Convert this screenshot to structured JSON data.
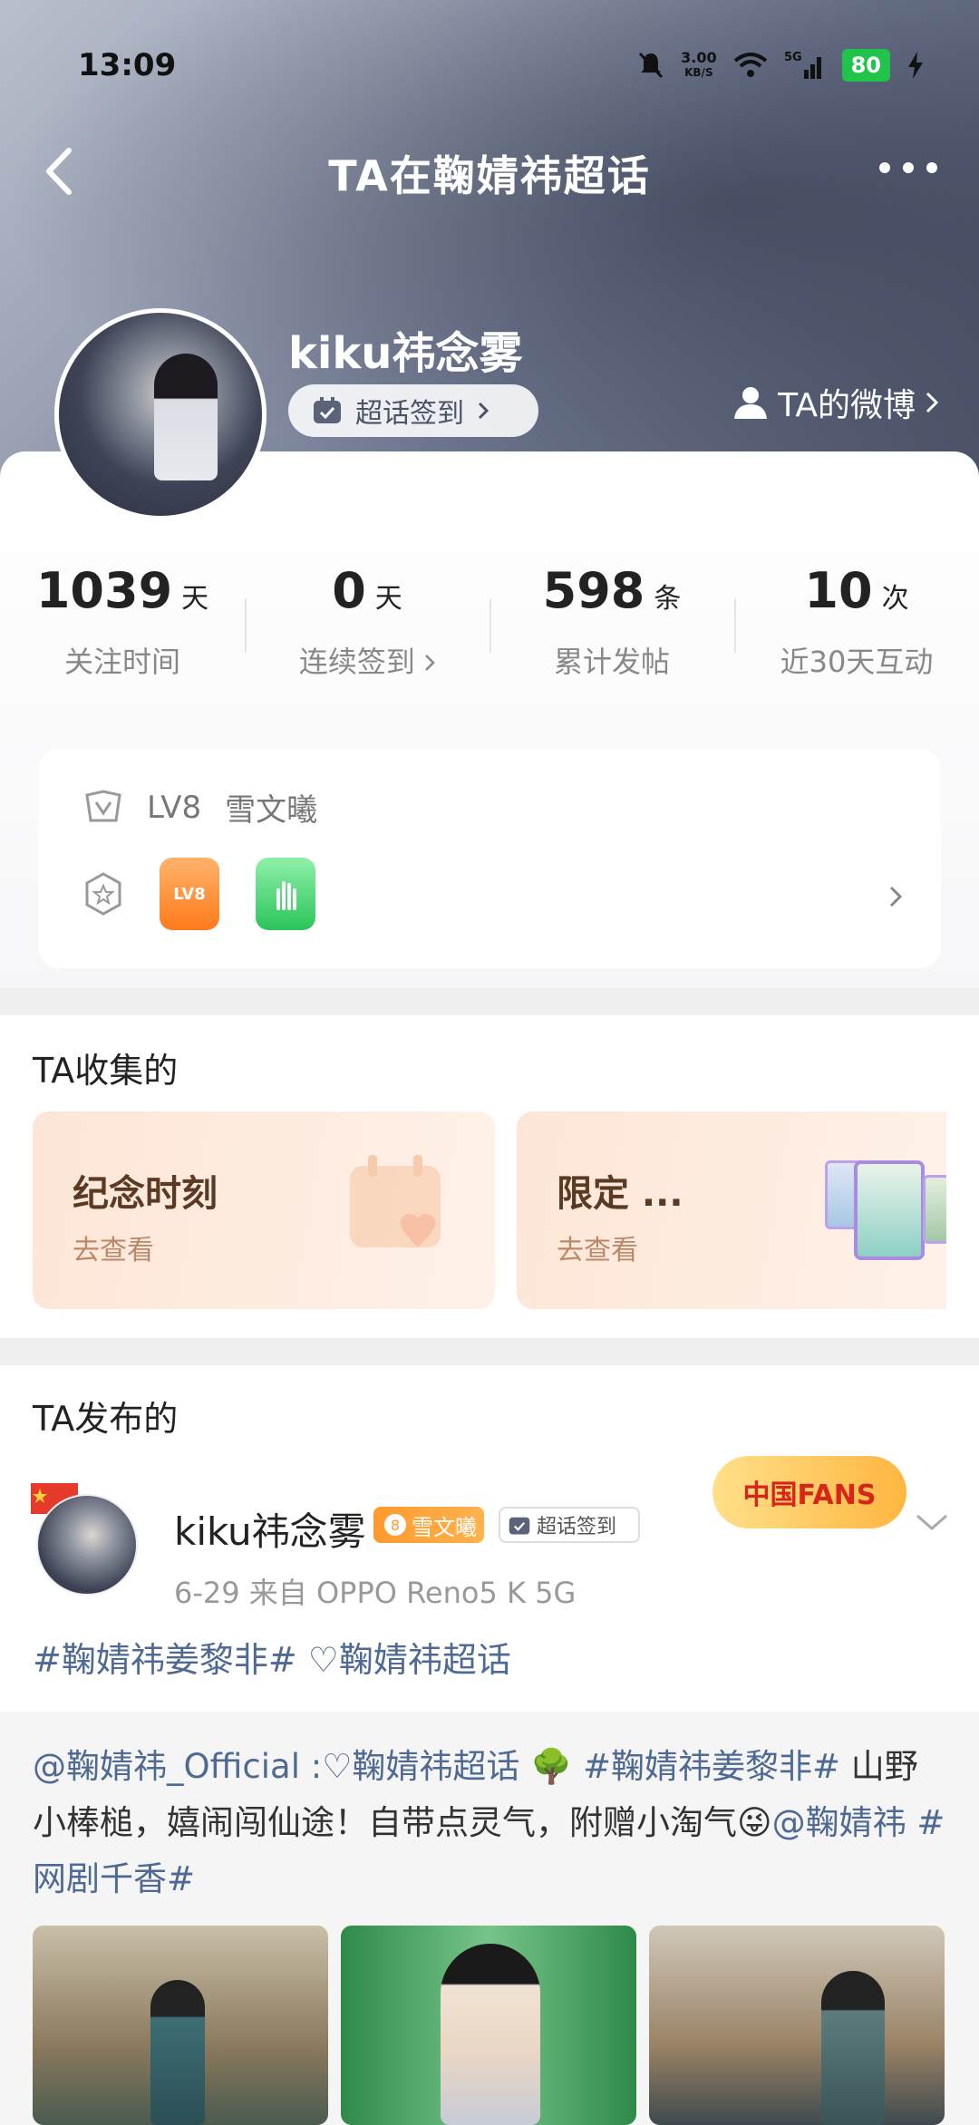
{
  "status_bar": {
    "time": "13:09",
    "speed_value": "3.00",
    "speed_unit": "KB/S",
    "network": "5G",
    "battery": "80"
  },
  "nav": {
    "title": "TA在鞠婧祎超话",
    "back_icon": "chevron-left-icon",
    "more_icon": "more-dots-icon"
  },
  "profile": {
    "username": "kiku祎念雾",
    "checkin_label": "超话签到",
    "weibo_link": "TA的微博"
  },
  "stats": [
    {
      "value": "1039",
      "unit": "天",
      "label": "关注时间"
    },
    {
      "value": "0",
      "unit": "天",
      "label": "连续签到"
    },
    {
      "value": "598",
      "unit": "条",
      "label": "累计发帖"
    },
    {
      "value": "10",
      "unit": "次",
      "label": "近30天互动"
    }
  ],
  "level": {
    "level_text": "LV8",
    "title": "雪文曦",
    "badge_lv": "LV8"
  },
  "collected": {
    "section_title": "TA收集的",
    "cards": [
      {
        "title": "纪念时刻",
        "link": "去查看"
      },
      {
        "title": "限定 ...",
        "link": "去查看"
      }
    ]
  },
  "posts": {
    "section_title": "TA发布的",
    "author": "kiku祎念雾",
    "level_num": "8",
    "level_name": "雪文曦",
    "checkin_tag": "超话签到",
    "fans_badge": "中国FANS",
    "meta": "6-29  来自 OPPO Reno5 K 5G",
    "topics": "#鞠婧祎姜黎非#  ♡鞠婧祎超话",
    "repost_mention": "@鞠婧祎_Official",
    "repost_part1": " :♡鞠婧祎超话  🌳 ",
    "repost_hashtag": "#鞠婧祎姜黎非#",
    "repost_body": " 山野小棒槌，嬉闹闯仙途！自带点灵气，附赠小淘气",
    "repost_emoji": "😜",
    "repost_mention2": "@鞠婧祎",
    "repost_hashtag2": " #网剧千香#"
  },
  "colors": {
    "accent_link": "#4f6a92",
    "battery_green": "#21c44a",
    "level_orange": "#ff9a2f"
  }
}
